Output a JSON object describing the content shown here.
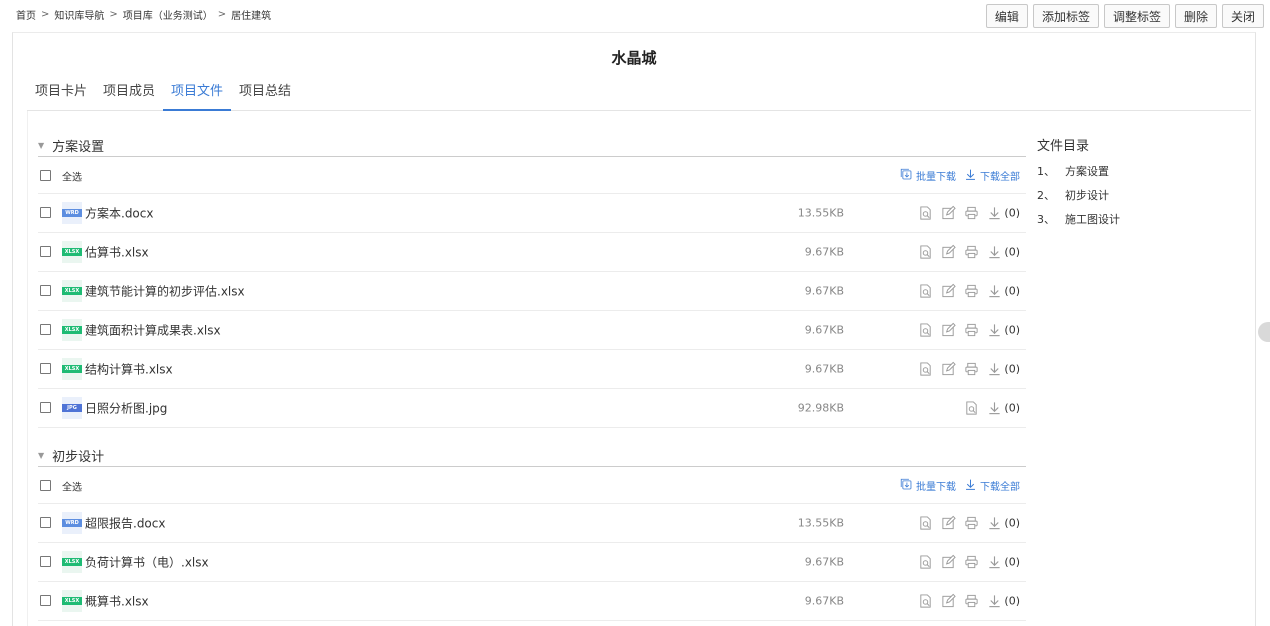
{
  "breadcrumb": [
    "首页",
    "知识库导航",
    "项目库（业务测试）",
    "居住建筑"
  ],
  "breadcrumb_sep": ">",
  "actions": [
    "编辑",
    "添加标签",
    "调整标签",
    "删除",
    "关闭"
  ],
  "title": "水晶城",
  "tabs": [
    "项目卡片",
    "项目成员",
    "项目文件",
    "项目总结"
  ],
  "active_tab": 2,
  "select_all": "全选",
  "batch_download": "批量下载",
  "download_all": "下载全部",
  "sections": [
    {
      "title": "方案设置",
      "files": [
        {
          "badge": "WRD",
          "name": "方案本.docx",
          "size": "13.55KB",
          "count": "(0)"
        },
        {
          "badge": "XLSX",
          "name": "估算书.xlsx",
          "size": "9.67KB",
          "count": "(0)"
        },
        {
          "badge": "XLSX",
          "name": "建筑节能计算的初步评估.xlsx",
          "size": "9.67KB",
          "count": "(0)"
        },
        {
          "badge": "XLSX",
          "name": "建筑面积计算成果表.xlsx",
          "size": "9.67KB",
          "count": "(0)"
        },
        {
          "badge": "XLSX",
          "name": "结构计算书.xlsx",
          "size": "9.67KB",
          "count": "(0)"
        },
        {
          "badge": "JPG",
          "name": "日照分析图.jpg",
          "size": "92.98KB",
          "count": "(0)"
        }
      ]
    },
    {
      "title": "初步设计",
      "files": [
        {
          "badge": "WRD",
          "name": "超限报告.docx",
          "size": "13.55KB",
          "count": "(0)"
        },
        {
          "badge": "XLSX",
          "name": "负荷计算书（电）.xlsx",
          "size": "9.67KB",
          "count": "(0)"
        },
        {
          "badge": "XLSX",
          "name": "概算书.xlsx",
          "size": "9.67KB",
          "count": "(0)"
        }
      ]
    }
  ],
  "catalog": {
    "title": "文件目录",
    "items": [
      {
        "num": "1、",
        "label": "方案设置"
      },
      {
        "num": "2、",
        "label": "初步设计"
      },
      {
        "num": "3、",
        "label": "施工图设计"
      }
    ]
  },
  "colors": {
    "accent": "#3a7bd5",
    "xlsx": "#1fbb74",
    "wrd": "#5d8ee0",
    "jpg": "#4f74d6"
  }
}
